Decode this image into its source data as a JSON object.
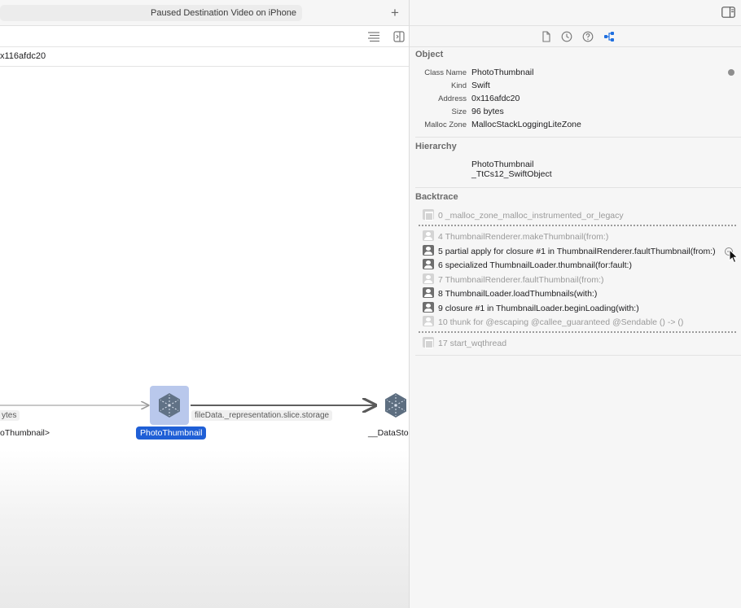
{
  "left": {
    "status_text": "Paused Destination Video on iPhone",
    "address_text": "x116afdc20",
    "graph": {
      "edge_in_label": "ytes",
      "edge_out_label": "fileData._representation.slice.storage",
      "left_node_label": "oThumbnail>",
      "selected_node_label": "PhotoThumbnail",
      "right_node_label": "__DataStor"
    }
  },
  "inspector": {
    "object": {
      "title": "Object",
      "rows": [
        {
          "key": "Class Name",
          "value": "PhotoThumbnail"
        },
        {
          "key": "Kind",
          "value": "Swift"
        },
        {
          "key": "Address",
          "value": "0x116afdc20"
        },
        {
          "key": "Size",
          "value": "96 bytes"
        },
        {
          "key": "Malloc Zone",
          "value": "MallocStackLoggingLiteZone"
        }
      ]
    },
    "hierarchy": {
      "title": "Hierarchy",
      "items": [
        "PhotoThumbnail",
        "_TtCs12_SwiftObject"
      ]
    },
    "backtrace": {
      "title": "Backtrace",
      "frames": [
        {
          "label": "0 _malloc_zone_malloc_instrumented_or_legacy",
          "kind": "sys",
          "active": false
        },
        {
          "label": "4 ThumbnailRenderer.makeThumbnail(from:)",
          "kind": "user",
          "active": false
        },
        {
          "label": "5 partial apply for closure #1 in ThumbnailRenderer.faultThumbnail(from:)",
          "kind": "user",
          "active": true
        },
        {
          "label": "6 specialized ThumbnailLoader.thumbnail(for:fault:)",
          "kind": "user",
          "active": true
        },
        {
          "label": "7 ThumbnailRenderer.faultThumbnail(from:)",
          "kind": "user",
          "active": false
        },
        {
          "label": "8 ThumbnailLoader.loadThumbnails(with:)",
          "kind": "user",
          "active": true
        },
        {
          "label": "9 closure #1 in ThumbnailLoader.beginLoading(with:)",
          "kind": "user",
          "active": true
        },
        {
          "label": "10 thunk for @escaping @callee_guaranteed @Sendable () -> ()",
          "kind": "user",
          "active": false
        },
        {
          "label": "17 start_wqthread",
          "kind": "sys",
          "active": false
        }
      ]
    }
  },
  "colors": {
    "selection": "#1f5fd6",
    "accent_tab": "#1f6fe0"
  },
  "icons": [
    "add-icon",
    "lines-icon",
    "sidebar-toggle-icon",
    "inspector-toggle-icon",
    "file-icon",
    "history-icon",
    "help-icon",
    "graph-icon",
    "class-icon",
    "go-forward-icon",
    "mouse-cursor-icon"
  ]
}
